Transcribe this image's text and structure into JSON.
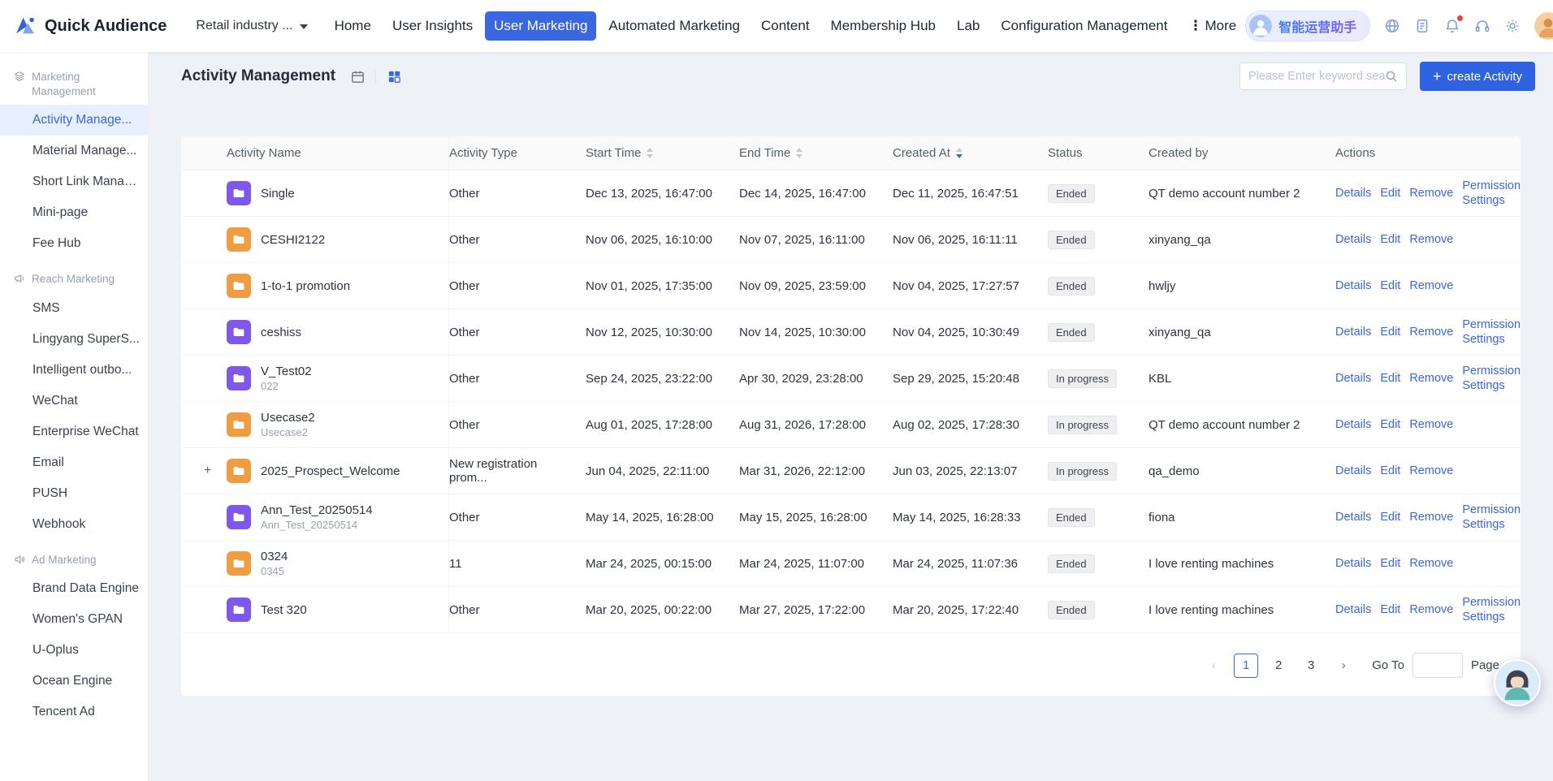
{
  "brand": {
    "name": "Quick Audience"
  },
  "colors": {
    "accent": "#2f62e0",
    "nav_active": "#3a66e0",
    "folder_purple": "#7e58ea",
    "folder_orange": "#f09c40",
    "badge_bg": "#efeff2"
  },
  "topnav": {
    "workspace": "Retail industry ...",
    "items": [
      {
        "label": "Home"
      },
      {
        "label": "User Insights"
      },
      {
        "label": "User Marketing",
        "active": true
      },
      {
        "label": "Automated Marketing"
      },
      {
        "label": "Content"
      },
      {
        "label": "Membership Hub"
      },
      {
        "label": "Lab"
      },
      {
        "label": "Configuration Management"
      },
      {
        "label": "More",
        "more": true
      }
    ],
    "assistant_label": "智能运营助手",
    "icons": [
      {
        "name": "globe-icon"
      },
      {
        "name": "guide-icon"
      },
      {
        "name": "bell-icon",
        "badge": true
      },
      {
        "name": "headset-icon"
      },
      {
        "name": "settings-icon"
      }
    ]
  },
  "sidebar": {
    "groups": [
      {
        "label": "Marketing Management",
        "icon": "layers-icon",
        "items": [
          {
            "label": "Activity Manage...",
            "active": true
          },
          {
            "label": "Material Manage..."
          },
          {
            "label": "Short Link Manag..."
          },
          {
            "label": "Mini-page"
          },
          {
            "label": "Fee Hub"
          }
        ]
      },
      {
        "label": "Reach Marketing",
        "icon": "megaphone-icon",
        "items": [
          {
            "label": "SMS"
          },
          {
            "label": "Lingyang SuperS..."
          },
          {
            "label": "Intelligent outbo..."
          },
          {
            "label": "WeChat"
          },
          {
            "label": "Enterprise WeChat"
          },
          {
            "label": "Email"
          },
          {
            "label": "PUSH"
          },
          {
            "label": "Webhook"
          }
        ]
      },
      {
        "label": "Ad Marketing",
        "icon": "speaker-icon",
        "items": [
          {
            "label": "Brand Data Engine"
          },
          {
            "label": "Women's GPAN"
          },
          {
            "label": "U-Oplus"
          },
          {
            "label": "Ocean Engine"
          },
          {
            "label": "Tencent Ad"
          }
        ]
      }
    ]
  },
  "page": {
    "title": "Activity Management",
    "view_icons": [
      "calendar-view-icon",
      "card-view-icon"
    ],
    "search_placeholder": "Please Enter keyword sea...",
    "create_icon": "+",
    "create_label": "create Activity"
  },
  "table": {
    "columns": [
      "Activity Name",
      "Activity Type",
      "Start Time",
      "End Time",
      "Created At",
      "Status",
      "Created by",
      "Actions"
    ],
    "sorted_column": "Created At",
    "rows": [
      {
        "folder": "purple",
        "name": "Single",
        "type": "Other",
        "start": "Dec 13, 2025, 16:47:00",
        "end": "Dec 14, 2025, 16:47:00",
        "created": "Dec 11, 2025, 16:47:51",
        "status": "Ended",
        "creator": "QT demo account number 2",
        "actions": [
          "Details",
          "Edit",
          "Remove",
          "Permission Settings"
        ]
      },
      {
        "folder": "orange",
        "name": "CESHI2122",
        "type": "Other",
        "start": "Nov 06, 2025, 16:10:00",
        "end": "Nov 07, 2025, 16:11:00",
        "created": "Nov 06, 2025, 16:11:11",
        "status": "Ended",
        "creator": "xinyang_qa",
        "actions": [
          "Details",
          "Edit",
          "Remove"
        ]
      },
      {
        "folder": "orange",
        "name": "1-to-1 promotion",
        "type": "Other",
        "start": "Nov 01, 2025, 17:35:00",
        "end": "Nov 09, 2025, 23:59:00",
        "created": "Nov 04, 2025, 17:27:57",
        "status": "Ended",
        "creator": "hwljy",
        "actions": [
          "Details",
          "Edit",
          "Remove"
        ]
      },
      {
        "folder": "purple",
        "name": "ceshiss",
        "type": "Other",
        "start": "Nov 12, 2025, 10:30:00",
        "end": "Nov 14, 2025, 10:30:00",
        "created": "Nov 04, 2025, 10:30:49",
        "status": "Ended",
        "creator": "xinyang_qa",
        "actions": [
          "Details",
          "Edit",
          "Remove",
          "Permission Settings"
        ]
      },
      {
        "folder": "purple",
        "name": "V_Test02",
        "subtitle": "022",
        "type": "Other",
        "start": "Sep 24, 2025, 23:22:00",
        "end": "Apr 30, 2029, 23:28:00",
        "created": "Sep 29, 2025, 15:20:48",
        "status": "In progress",
        "creator": "KBL",
        "actions": [
          "Details",
          "Edit",
          "Remove",
          "Permission Settings"
        ]
      },
      {
        "folder": "orange",
        "name": "Usecase2",
        "subtitle": "Usecase2",
        "type": "Other",
        "start": "Aug 01, 2025, 17:28:00",
        "end": "Aug 31, 2026, 17:28:00",
        "created": "Aug 02, 2025, 17:28:30",
        "status": "In progress",
        "creator": "QT demo account number 2",
        "actions": [
          "Details",
          "Edit",
          "Remove"
        ]
      },
      {
        "folder": "orange",
        "expandable": true,
        "name": "2025_Prospect_Welcome",
        "type": "New registration prom...",
        "start": "Jun 04, 2025, 22:11:00",
        "end": "Mar 31, 2026, 22:12:00",
        "created": "Jun 03, 2025, 22:13:07",
        "status": "In progress",
        "creator": "qa_demo",
        "actions": [
          "Details",
          "Edit",
          "Remove"
        ]
      },
      {
        "folder": "purple",
        "name": "Ann_Test_20250514",
        "subtitle": "Ann_Test_20250514",
        "type": "Other",
        "start": "May 14, 2025, 16:28:00",
        "end": "May 15, 2025, 16:28:00",
        "created": "May 14, 2025, 16:28:33",
        "status": "Ended",
        "creator": "fiona",
        "actions": [
          "Details",
          "Edit",
          "Remove",
          "Permission Settings"
        ]
      },
      {
        "folder": "orange",
        "name": "0324",
        "subtitle": "0345",
        "type": "11",
        "start": "Mar 24, 2025, 00:15:00",
        "end": "Mar 24, 2025, 11:07:00",
        "created": "Mar 24, 2025, 11:07:36",
        "status": "Ended",
        "creator": "I love renting machines",
        "actions": [
          "Details",
          "Edit",
          "Remove"
        ]
      },
      {
        "folder": "purple",
        "name": "Test 320",
        "type": "Other",
        "start": "Mar 20, 2025, 00:22:00",
        "end": "Mar 27, 2025, 17:22:00",
        "created": "Mar 20, 2025, 17:22:40",
        "status": "Ended",
        "creator": "I love renting machines",
        "actions": [
          "Details",
          "Edit",
          "Remove",
          "Permission Settings"
        ]
      }
    ]
  },
  "pagination": {
    "prev": "‹",
    "next": "›",
    "pages": [
      "1",
      "2",
      "3"
    ],
    "current": "1",
    "goto_label": "Go To",
    "goto_value": "",
    "page_label": "Page"
  }
}
